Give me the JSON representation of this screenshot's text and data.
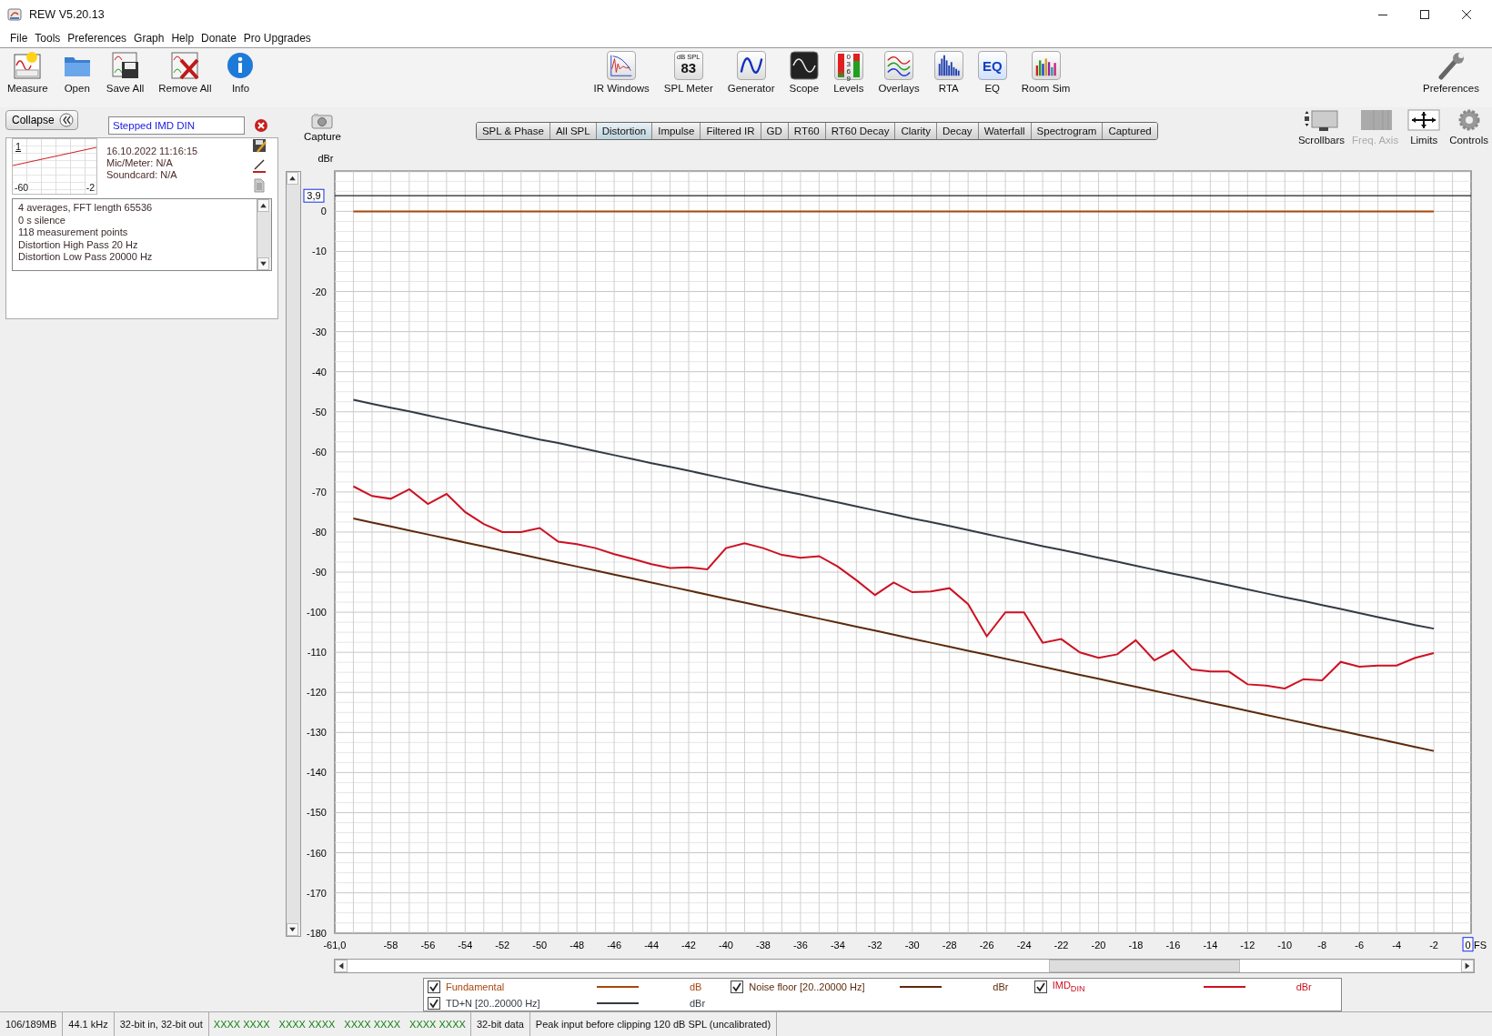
{
  "window": {
    "title": "REW V5.20.13"
  },
  "menu": [
    "File",
    "Tools",
    "Preferences",
    "Graph",
    "Help",
    "Donate",
    "Pro Upgrades"
  ],
  "toolbar_left": [
    {
      "label": "Measure",
      "kind": "measure"
    },
    {
      "label": "Open",
      "kind": "open"
    },
    {
      "label": "Save All",
      "kind": "save"
    },
    {
      "label": "Remove All",
      "kind": "remove"
    },
    {
      "label": "Info",
      "kind": "info"
    }
  ],
  "toolbar_center": [
    {
      "label": "IR Windows",
      "kind": "ir"
    },
    {
      "label": "SPL Meter",
      "kind": "spl",
      "icon_text": [
        "dB SPL",
        "83"
      ]
    },
    {
      "label": "Generator",
      "kind": "generator"
    },
    {
      "label": "Scope",
      "kind": "scope"
    },
    {
      "label": "Levels",
      "kind": "levels",
      "icon_text": [
        "0",
        "3",
        "6",
        "9"
      ]
    },
    {
      "label": "Overlays",
      "kind": "overlays"
    },
    {
      "label": "RTA",
      "kind": "rta"
    },
    {
      "label": "EQ",
      "kind": "eq",
      "icon_text": [
        "EQ"
      ]
    },
    {
      "label": "Room Sim",
      "kind": "roomsim"
    }
  ],
  "toolbar_right": [
    {
      "label": "Preferences",
      "kind": "preferences"
    }
  ],
  "collapse_button": "Collapse",
  "measurement": {
    "name": "Stepped IMD DIN",
    "index": "1",
    "axis_min": "-60",
    "axis_max": "-2",
    "date": "16.10.2022 11:16:15",
    "mic": "Mic/Meter: N/A",
    "soundcard": "Soundcard: N/A",
    "notes": [
      "4 averages, FFT length 65536",
      "0 s silence",
      "118 measurement points",
      "Distortion High Pass 20 Hz",
      "Distortion Low Pass 20000 Hz"
    ]
  },
  "capture_button": "Capture",
  "graph_tabs": [
    {
      "label": "SPL & Phase",
      "selected": false
    },
    {
      "label": "All SPL",
      "selected": false
    },
    {
      "label": "Distortion",
      "selected": true
    },
    {
      "label": "Impulse",
      "selected": false
    },
    {
      "label": "Filtered IR",
      "selected": false
    },
    {
      "label": "GD",
      "selected": false
    },
    {
      "label": "RT60",
      "selected": false
    },
    {
      "label": "RT60 Decay",
      "selected": false
    },
    {
      "label": "Clarity",
      "selected": false
    },
    {
      "label": "Decay",
      "selected": false
    },
    {
      "label": "Waterfall",
      "selected": false
    },
    {
      "label": "Spectrogram",
      "selected": false
    },
    {
      "label": "Captured",
      "selected": false
    }
  ],
  "graph_tools": [
    {
      "label": "Scrollbars",
      "kind": "scrollbars",
      "disabled": false
    },
    {
      "label": "Freq. Axis",
      "kind": "freqaxis",
      "disabled": true
    },
    {
      "label": "Limits",
      "kind": "limits",
      "disabled": false
    },
    {
      "label": "Controls",
      "kind": "controls",
      "disabled": false
    }
  ],
  "chart": {
    "chart_data": {
      "type": "line",
      "ylabel": "dBr",
      "xlabel": "FS",
      "x": [
        -60,
        -59,
        -58,
        -57,
        -56,
        -55,
        -54,
        -53,
        -52,
        -51,
        -50,
        -49,
        -48,
        -47,
        -46,
        -45,
        -44,
        -43,
        -42,
        -41,
        -40,
        -39,
        -38,
        -37,
        -36,
        -35,
        -34,
        -33,
        -32,
        -31,
        -30,
        -29,
        -28,
        -27,
        -26,
        -25,
        -24,
        -23,
        -22,
        -21,
        -20,
        -19,
        -18,
        -17,
        -16,
        -15,
        -14,
        -13,
        -12,
        -11,
        -10,
        -9,
        -8,
        -7,
        -6,
        -5,
        -4,
        -3,
        -2
      ],
      "series": [
        {
          "name": "Fundamental",
          "color": "#a8460c",
          "values": [
            0,
            0,
            0,
            0,
            0,
            0,
            0,
            0,
            0,
            0,
            0,
            0,
            0,
            0,
            0,
            0,
            0,
            0,
            0,
            0,
            0,
            0,
            0,
            0,
            0,
            0,
            0,
            0,
            0,
            0,
            0,
            0,
            0,
            0,
            0,
            0,
            0,
            0,
            0,
            0,
            0,
            0,
            0,
            0,
            0,
            0,
            0,
            0,
            0,
            0,
            0,
            0,
            0,
            0,
            0,
            0,
            0,
            0,
            0
          ]
        },
        {
          "name": "Noise floor [20..20000 Hz]",
          "color": "#5c2a0c",
          "values": [
            -76.6,
            -77.6,
            -78.6,
            -79.6,
            -80.6,
            -81.6,
            -82.6,
            -83.6,
            -84.6,
            -85.6,
            -86.6,
            -87.6,
            -88.6,
            -89.6,
            -90.6,
            -91.6,
            -92.6,
            -93.6,
            -94.6,
            -95.6,
            -96.6,
            -97.6,
            -98.6,
            -99.6,
            -100.6,
            -101.6,
            -102.6,
            -103.6,
            -104.6,
            -105.6,
            -106.6,
            -107.6,
            -108.6,
            -109.6,
            -110.6,
            -111.6,
            -112.6,
            -113.6,
            -114.6,
            -115.6,
            -116.6,
            -117.6,
            -118.6,
            -119.6,
            -120.6,
            -121.6,
            -122.6,
            -123.6,
            -124.6,
            -125.6,
            -126.6,
            -127.6,
            -128.6,
            -129.6,
            -130.6,
            -131.6,
            -132.6,
            -133.6,
            -134.6
          ]
        },
        {
          "name": "IMD$_{DIN}$",
          "color": "#cc1122",
          "values": [
            -68.6,
            -71,
            -71.7,
            -69.3,
            -73,
            -70.5,
            -75,
            -78,
            -80,
            -80,
            -79,
            -82.4,
            -83,
            -84,
            -85.5,
            -86.7,
            -88,
            -89,
            -88.8,
            -89.3,
            -84,
            -82.8,
            -84,
            -85.7,
            -86.4,
            -86,
            -88.6,
            -92,
            -95.7,
            -92.6,
            -95,
            -94.8,
            -94,
            -98,
            -106,
            -100,
            -100,
            -107.6,
            -106.7,
            -110,
            -111.4,
            -110.5,
            -107,
            -112,
            -109.5,
            -114.3,
            -114.8,
            -114.8,
            -118,
            -118.3,
            -119,
            -116.7,
            -117,
            -112.4,
            -113.6,
            -113.3,
            -113.3,
            -111.4,
            -110.2
          ]
        },
        {
          "name": "TD+N [20..20000 Hz]",
          "color": "#343a44",
          "values": [
            -47,
            -48,
            -49,
            -49.9,
            -50.9,
            -51.9,
            -52.9,
            -53.9,
            -54.9,
            -55.9,
            -56.9,
            -57.8,
            -58.8,
            -59.8,
            -60.8,
            -61.8,
            -62.8,
            -63.7,
            -64.7,
            -65.7,
            -66.7,
            -67.7,
            -68.7,
            -69.7,
            -70.6,
            -71.6,
            -72.6,
            -73.6,
            -74.6,
            -75.6,
            -76.6,
            -77.5,
            -78.5,
            -79.5,
            -80.5,
            -81.5,
            -82.5,
            -83.5,
            -84.4,
            -85.4,
            -86.4,
            -87.4,
            -88.4,
            -89.4,
            -90.4,
            -91.3,
            -92.3,
            -93.3,
            -94.3,
            -95.3,
            -96.3,
            -97.2,
            -98.2,
            -99.2,
            -100.2,
            -101.2,
            -102.2,
            -103.2,
            -104.1
          ]
        }
      ],
      "xlim": [
        -61,
        0
      ],
      "ylim": [
        -180,
        10
      ],
      "xticks": [
        {
          "value": -61,
          "label": "-61,0"
        },
        -58,
        -56,
        -54,
        -52,
        -50,
        -48,
        -46,
        -44,
        -42,
        -40,
        -38,
        -36,
        -34,
        -32,
        -30,
        -28,
        -26,
        -24,
        -22,
        -20,
        -18,
        -16,
        -14,
        -12,
        -10,
        -8,
        -6,
        -4,
        -2
      ],
      "yticks": [
        0,
        -10,
        -20,
        -30,
        -40,
        -50,
        -60,
        -70,
        -80,
        -90,
        -100,
        -110,
        -120,
        -130,
        -140,
        -150,
        -160,
        -170,
        -180
      ],
      "grid": true,
      "ref_lines": [
        {
          "axis": "y",
          "value": 3.9,
          "color": "#222222"
        }
      ]
    },
    "cursor_y_readout": "3,9",
    "cursor_x_readout": "0"
  },
  "legend": [
    {
      "unit": "dB",
      "checked": true
    },
    {
      "unit": "dBr",
      "checked": true
    },
    {
      "unit": "dBr",
      "checked": true
    },
    {
      "unit": "dBr",
      "checked": true
    }
  ],
  "status_bar": [
    {
      "text": "106/189MB",
      "kind": "plain"
    },
    {
      "text": "44.1 kHz",
      "kind": "plain"
    },
    {
      "text": "32-bit in, 32-bit out",
      "kind": "plain"
    },
    {
      "text": "XXXX XXXX",
      "kind": "meter"
    },
    {
      "text": "XXXX XXXX",
      "kind": "meter"
    },
    {
      "text": "XXXX XXXX",
      "kind": "meter"
    },
    {
      "text": "XXXX XXXX",
      "kind": "meter"
    },
    {
      "text": "32-bit data",
      "kind": "plain"
    },
    {
      "text": "Peak input before clipping 120 dB SPL (uncalibrated)",
      "kind": "plain"
    }
  ]
}
